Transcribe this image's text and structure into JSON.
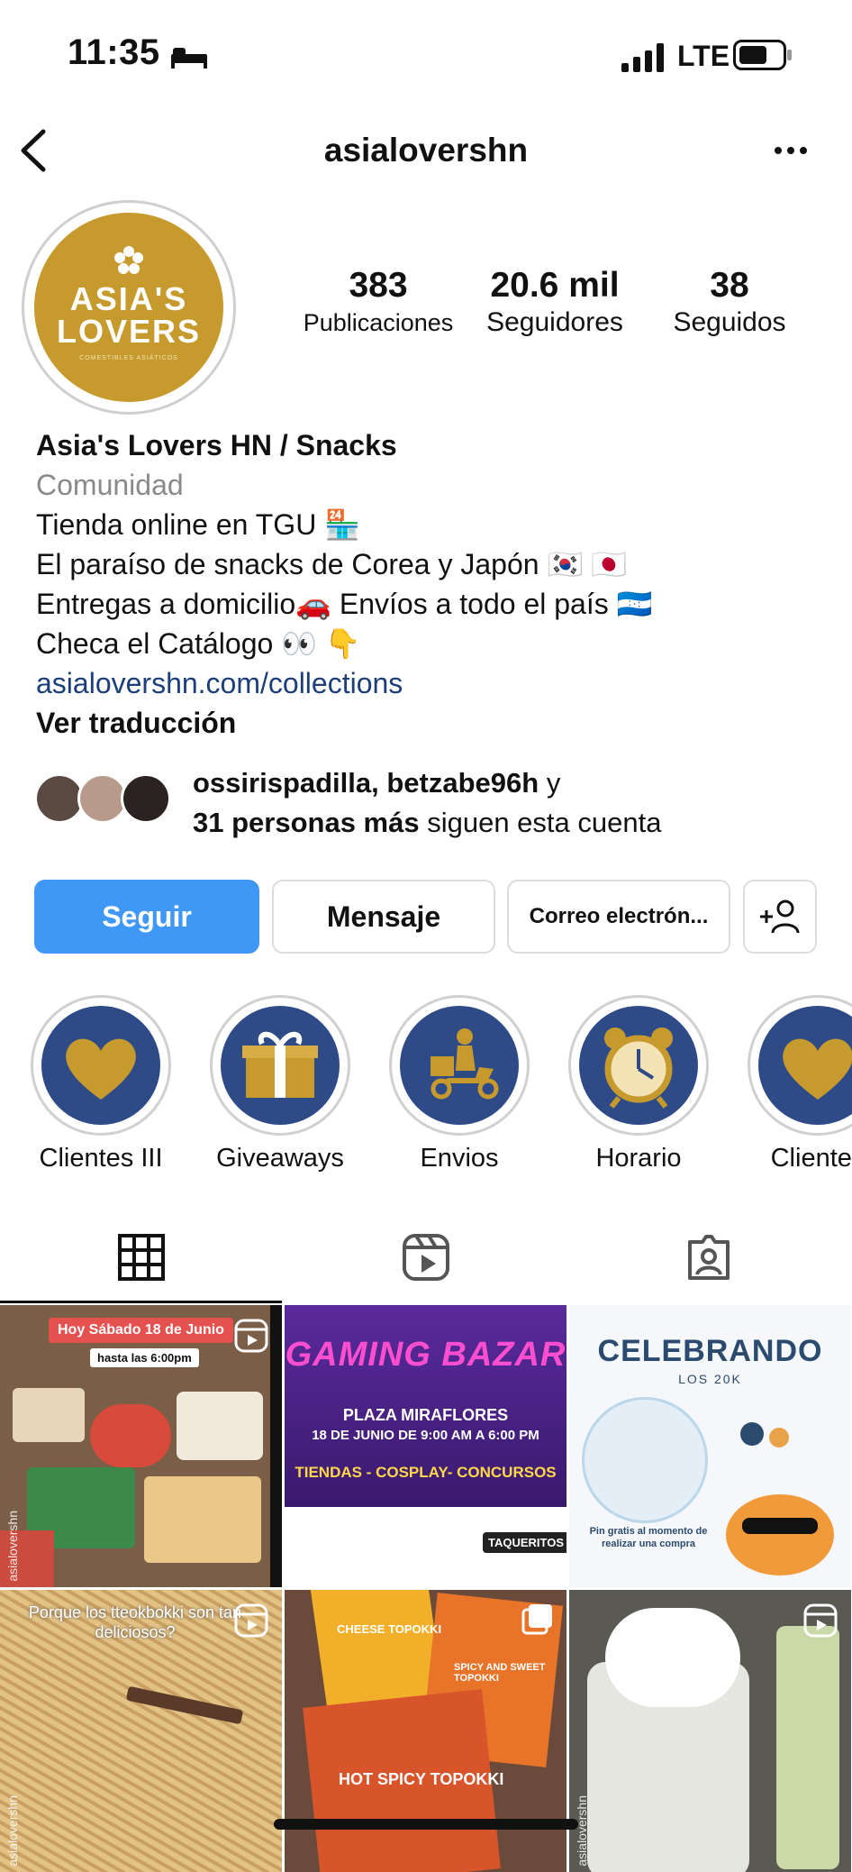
{
  "status": {
    "time": "11:35",
    "network": "LTE"
  },
  "nav": {
    "title": "asialovershn"
  },
  "profile": {
    "logo_line1": "ASIA'S",
    "logo_line2": "LOVERS",
    "logo_sub": "COMESTIBLES ASIÁTICOS",
    "stats": [
      {
        "value": "383",
        "label": "Publicaciones"
      },
      {
        "value": "20.6 mil",
        "label": "Seguidores"
      },
      {
        "value": "38",
        "label": "Seguidos"
      }
    ],
    "name": "Asia's Lovers HN / Snacks",
    "category": "Comunidad",
    "bio_lines": [
      "Tienda online en TGU 🏪",
      "El paraíso de snacks de Corea y Japón 🇰🇷 🇯🇵",
      "Entregas a domicilio🚗 Envíos a todo el país 🇭🇳",
      "Checa el Catálogo 👀 👇"
    ],
    "link": "asialovershn.com/collections",
    "translate": "Ver traducción",
    "followed_by_names": "ossirispadilla, betzabe96h",
    "followed_by_y": " y",
    "followed_by_count": "31 personas más",
    "followed_by_suffix": " siguen esta cuenta"
  },
  "buttons": {
    "follow": "Seguir",
    "message": "Mensaje",
    "email": "Correo electrón..."
  },
  "highlights": [
    {
      "label": "Clientes III",
      "icon": "heart-icon"
    },
    {
      "label": "Giveaways",
      "icon": "gift-icon"
    },
    {
      "label": "Envios",
      "icon": "delivery-scooter-icon"
    },
    {
      "label": "Horario",
      "icon": "alarm-clock-icon"
    },
    {
      "label": "Clientes",
      "icon": "heart-icon"
    }
  ],
  "posts": {
    "p1": {
      "banner": "Hoy Sábado 18 de Junio",
      "sub": "hasta las 6:00pm",
      "handle": "asialovershn"
    },
    "p2": {
      "title": "GAMING BAZAR",
      "line1": "PLAZA MIRAFLORES",
      "line2": "18 DE JUNIO DE 9:00 AM A 6:00 PM",
      "line3": "TIENDAS - COSPLAY- CONCURSOS",
      "sponsor": "TAQUERITOS"
    },
    "p3": {
      "title": "CELEBRANDO",
      "sub": "LOS 20K",
      "caption": "Pin gratis al momento de realizar una compra"
    },
    "p4": {
      "caption": "Porque los tteokbokki son tan deliciosos?",
      "handle": "asialovershn"
    },
    "p5": {
      "label1": "CHEESE TOPOKKI",
      "label2": "SPICY AND SWEET TOPOKKI",
      "label3": "HOT SPICY TOPOKKI"
    },
    "p6": {
      "handle": "asialovershn"
    }
  },
  "colors": {
    "accent": "#3f97f6",
    "gold": "#c79a2e",
    "navy": "#2e4b87",
    "link": "#1c3f7a"
  }
}
